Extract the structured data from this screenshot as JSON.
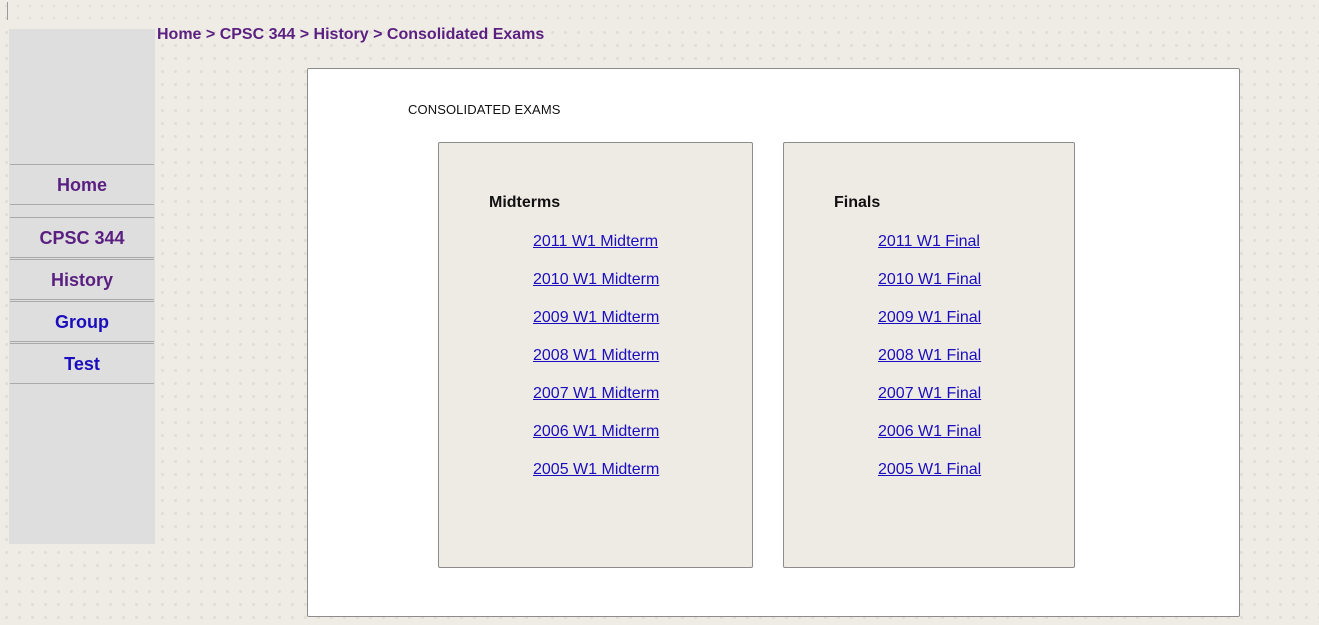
{
  "breadcrumb": {
    "items": [
      "Home",
      "CPSC 344",
      "History",
      "Consolidated Exams"
    ],
    "separator": ">"
  },
  "sidebar": {
    "items": [
      {
        "label": "Home",
        "state": "visited"
      },
      {
        "label": "CPSC 344",
        "state": "visited"
      },
      {
        "label": "History",
        "state": "visited"
      },
      {
        "label": "Group",
        "state": "unvisited"
      },
      {
        "label": "Test",
        "state": "unvisited"
      }
    ]
  },
  "main": {
    "title": "CONSOLIDATED EXAMS",
    "midterms": {
      "heading": "Midterms",
      "links": [
        "2011 W1 Midterm",
        "2010 W1 Midterm",
        "2009 W1 Midterm",
        "2008 W1 Midterm",
        "2007 W1 Midterm",
        "2006 W1 Midterm",
        "2005 W1 Midterm"
      ]
    },
    "finals": {
      "heading": "Finals",
      "links": [
        "2011 W1 Final",
        "2010 W1 Final",
        "2009 W1 Final",
        "2008 W1 Final",
        "2007 W1 Final",
        "2006 W1 Final",
        "2005 W1 Final"
      ]
    }
  },
  "colors": {
    "visited_link": "#5a1f80",
    "unvisited_link": "#1a0dbd",
    "sidebar_bg": "#dedede",
    "box_bg": "#eeebe5"
  }
}
